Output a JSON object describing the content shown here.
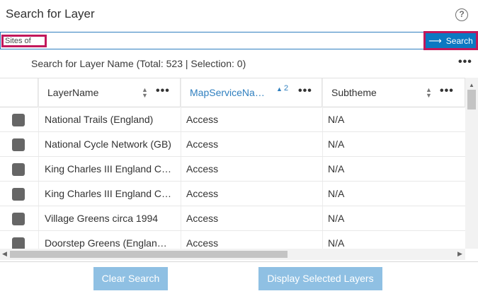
{
  "header": {
    "title": "Search for Layer"
  },
  "search": {
    "chip_label": "Sites of",
    "value": "",
    "button_label": "Search"
  },
  "status": {
    "text": "Search for Layer Name (Total: 523 | Selection: 0)"
  },
  "grid": {
    "columns": [
      {
        "label": "LayerName",
        "sorted": false
      },
      {
        "label": "MapServiceNa…",
        "sorted": true,
        "sort_order": "2"
      },
      {
        "label": "Subtheme",
        "sorted": false
      }
    ],
    "rows": [
      {
        "layer": "National Trails (England)",
        "service": "Access",
        "subtheme": "N/A"
      },
      {
        "layer": "National Cycle Network (GB)",
        "service": "Access",
        "subtheme": "N/A"
      },
      {
        "layer": "King Charles III England C…",
        "service": "Access",
        "subtheme": "N/A"
      },
      {
        "layer": "King Charles III England C…",
        "service": "Access",
        "subtheme": "N/A"
      },
      {
        "layer": "Village Greens circa 1994",
        "service": "Access",
        "subtheme": "N/A"
      },
      {
        "layer": "Doorstep Greens (Englan…",
        "service": "Access",
        "subtheme": "N/A"
      }
    ]
  },
  "footer": {
    "clear_label": "Clear Search",
    "display_label": "Display Selected Layers"
  },
  "colors": {
    "accent": "#0b78c2",
    "highlight": "#c2185b",
    "button_disabled": "#8fc0e3"
  }
}
